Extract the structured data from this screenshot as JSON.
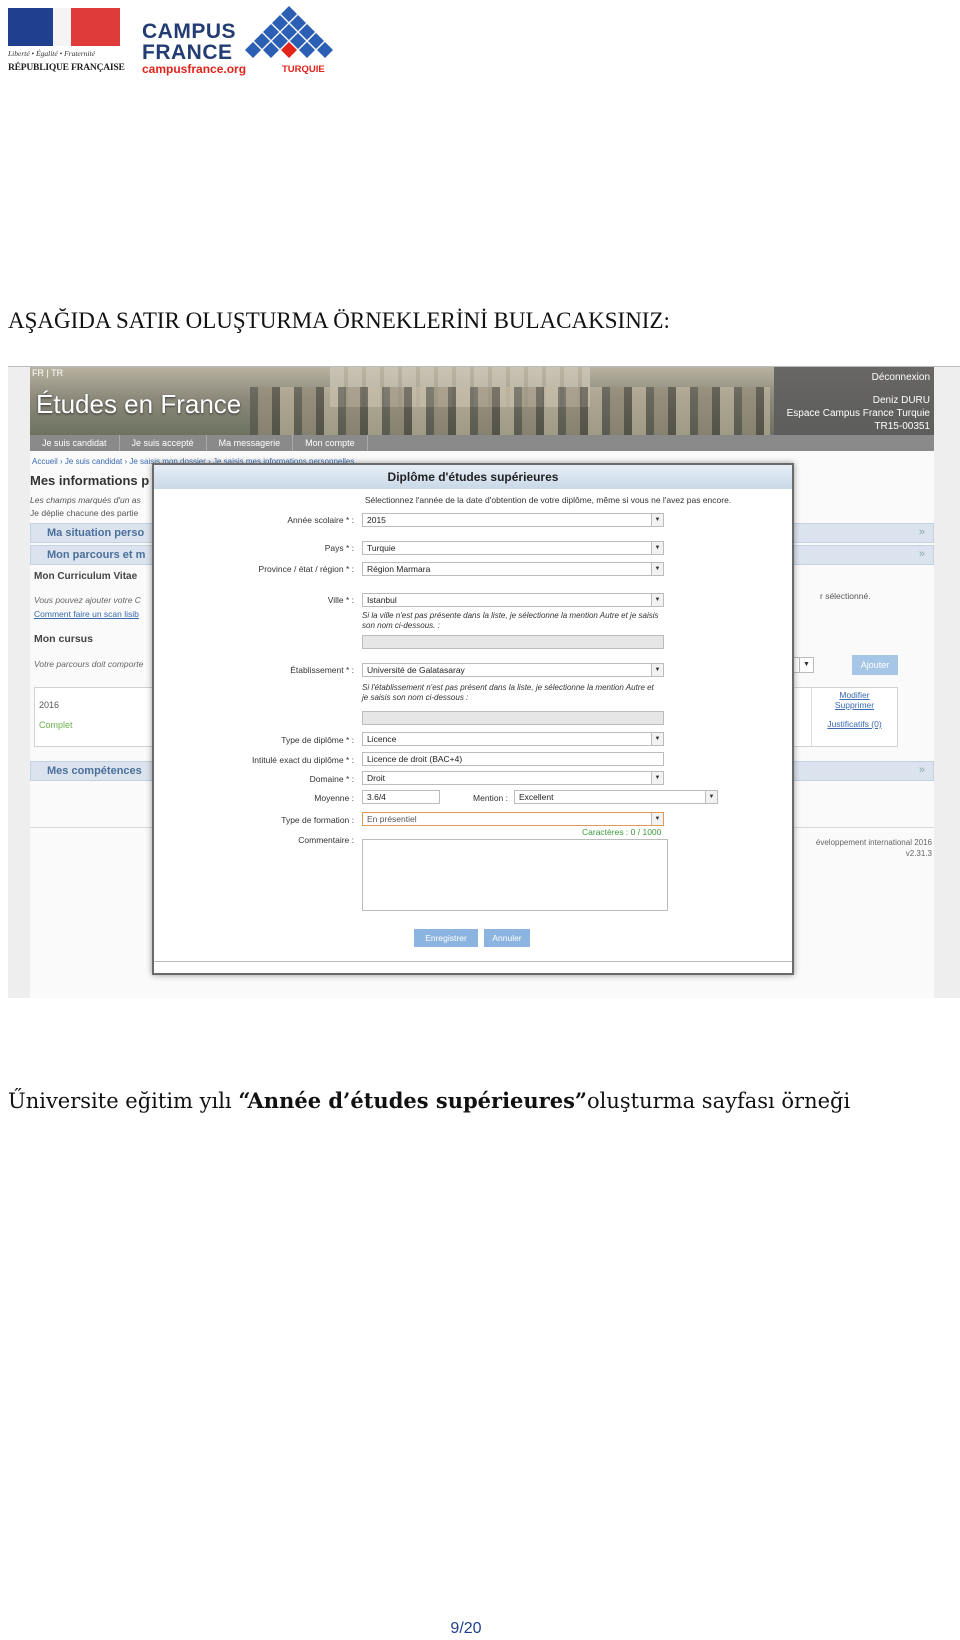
{
  "logos": {
    "republic_motto": "Liberté • Égalité • Fraternité",
    "republic_name": "RÉPUBLIQUE FRANÇAISE",
    "campus_line1": "CAMPUS",
    "campus_line2": "FRANCE",
    "campus_url": "campusfrance.org",
    "campus_country": "TURQUIE",
    "colors": {
      "flag_blue": "#1f3f8f",
      "flag_red": "#e03b3b",
      "brand_navy": "#233d73",
      "brand_red": "#e2231a",
      "diamond_blue": "#2a5fb4"
    }
  },
  "heading": "AŞAĞIDA SATIR OLUŞTURMA ÖRNEKLERİNİ BULACAKSINIZ:",
  "screenshot": {
    "lang_switch": "FR | TR",
    "site_title": "Études en France",
    "logout": "Déconnexion",
    "user_name": "Deniz DURU",
    "user_space": "Espace Campus France Turquie",
    "user_id": "TR15-00351",
    "nav": [
      "Je suis candidat",
      "Je suis accepté",
      "Ma messagerie",
      "Mon compte"
    ],
    "breadcrumb": "Accueil › Je suis candidat › Je saisis mon dossier › Je saisis mes informations personnelles",
    "page_title": "Mes informations p",
    "page_note1": "Les champs marqués d'un as",
    "page_note2": "Je déplie chacune des partie",
    "accordions": [
      "Ma situation perso",
      "Mon parcours et m",
      "Mes compétences"
    ],
    "accordion_arrows": [
      "»",
      "»",
      "»"
    ],
    "cv_title": "Mon Curriculum Vitae",
    "cv_note": "Vous pouvez ajouter votre C",
    "cv_link": "Comment faire un scan lisib",
    "selected_note": "r sélectionné.",
    "cursus_title": "Mon cursus",
    "cursus_note": "Votre parcours doit comporte",
    "add_button": "Ajouter",
    "entry": {
      "year": "2016",
      "status": "Complet",
      "modify": "Modifier",
      "delete": "Supprimer",
      "proofs": "Justificatifs (0)"
    },
    "footer_line1": "éveloppement international 2016",
    "footer_line2": "v2.31.3",
    "modal": {
      "title": "Diplôme d'études supérieures",
      "intro": "Sélectionnez l'année de la date d'obtention de votre diplôme, même si vous ne l'avez pas encore.",
      "fields": {
        "annee_label": "Année scolaire * :",
        "annee_value": "2015",
        "pays_label": "Pays * :",
        "pays_value": "Turquie",
        "province_label": "Province / état / région * :",
        "province_value": "Région Marmara",
        "ville_label": "Ville * :",
        "ville_value": "Istanbul",
        "ville_hint": "Si la ville n'est pas présente dans la liste, je sélectionne la mention Autre et je saisis son nom ci-dessous. :",
        "etab_label": "Établissement * :",
        "etab_value": "Université de Galatasaray",
        "etab_hint": "Si l'établissement n'est pas présent dans la liste, je sélectionne la mention Autre et je saisis son nom ci-dessous :",
        "type_label": "Type de diplôme * :",
        "type_value": "Licence",
        "intitule_label": "Intitulé exact du diplôme * :",
        "intitule_value": "Licence de droit (BAC+4)",
        "domaine_label": "Domaine * :",
        "domaine_value": "Droit",
        "moyenne_label": "Moyenne :",
        "moyenne_value": "3.6/4",
        "mention_label": "Mention :",
        "mention_value": "Excellent",
        "formation_label": "Type de formation :",
        "formation_value": "En présentiel",
        "commentaire_label": "Commentaire :",
        "chars_counter": "Caractères : 0 / 1000"
      },
      "save_button": "Enregistrer",
      "cancel_button": "Annuler"
    }
  },
  "caption_pre": "Űniversite eğitim yılı ",
  "caption_bold": "“Année d’études supérieures”",
  "caption_post": "oluşturma sayfası örneği",
  "page_number": "9/20"
}
